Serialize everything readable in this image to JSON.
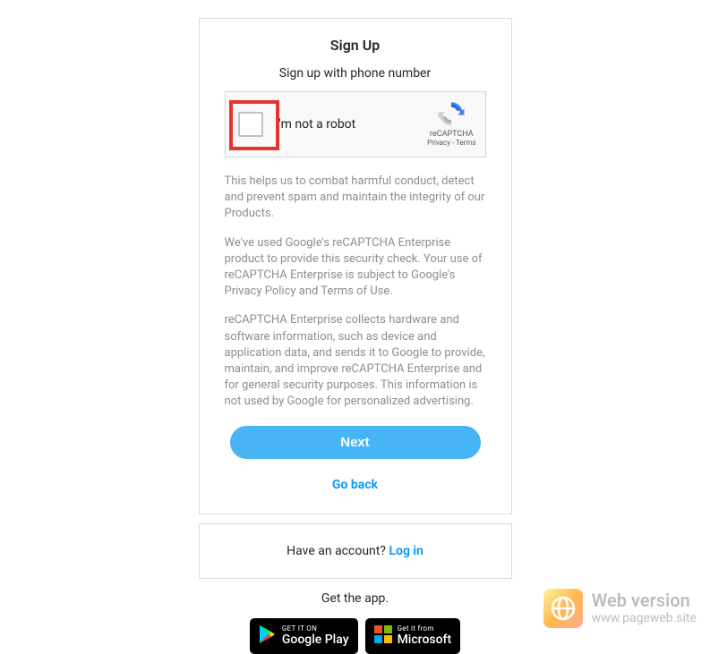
{
  "signup": {
    "title": "Sign Up",
    "subtitle": "Sign up with phone number"
  },
  "recaptcha": {
    "robot_label": "I'm not a robot",
    "brand": "reCAPTCHA",
    "privacy": "Privacy",
    "terms": "Terms",
    "separator": " - "
  },
  "info": {
    "p1": "This helps us to combat harmful conduct, detect and prevent spam and maintain the integrity of our Products.",
    "p2": "We've used Google's reCAPTCHA Enterprise product to provide this security check. Your use of reCAPTCHA Enterprise is subject to Google's Privacy Policy and Terms of Use.",
    "p3": "reCAPTCHA Enterprise collects hardware and software information, such as device and application data, and sends it to Google to provide, maintain, and improve reCAPTCHA Enterprise and for general security purposes. This information is not used by Google for personalized advertising."
  },
  "actions": {
    "next": "Next",
    "go_back": "Go back"
  },
  "login": {
    "prompt": "Have an account? ",
    "link": "Log in"
  },
  "get_app": {
    "label": "Get the app.",
    "google_small": "GET IT ON",
    "google_big": "Google Play",
    "ms_small": "Get it from",
    "ms_big": "Microsoft"
  },
  "watermark": {
    "title": "Web version",
    "url": "www.pageweb.site"
  }
}
